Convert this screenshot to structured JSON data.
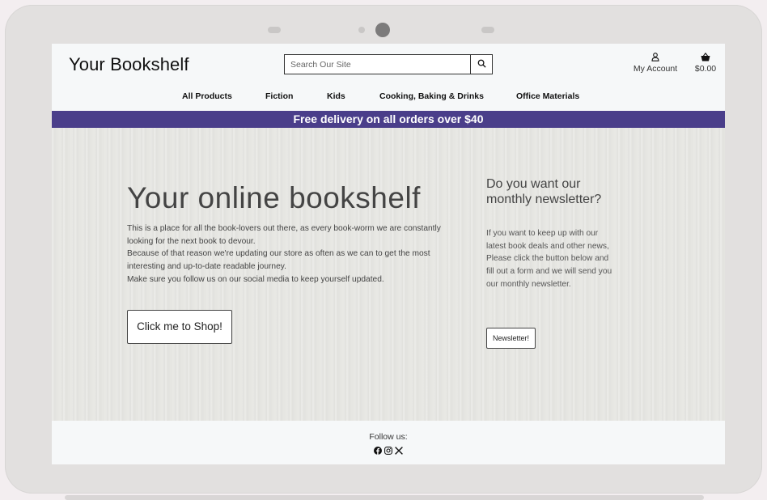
{
  "site": {
    "logo": "Your Bookshelf"
  },
  "search": {
    "placeholder": "Search Our Site",
    "icon": "search-icon"
  },
  "account": {
    "label": "My Account",
    "icon": "user-icon"
  },
  "cart": {
    "total": "$0.00",
    "icon": "basket-icon"
  },
  "nav": {
    "items": [
      {
        "label": "All Products"
      },
      {
        "label": "Fiction"
      },
      {
        "label": "Kids"
      },
      {
        "label": "Cooking, Baking & Drinks"
      },
      {
        "label": "Office Materials"
      }
    ]
  },
  "banner": {
    "text": "Free delivery on all orders over $40"
  },
  "hero": {
    "title": "Your online bookshelf",
    "paragraphs": [
      "This is a place for all the book-lovers out there, as every book-worm we are constantly looking for the next book to devour.",
      "Because of that reason we're updating our store as often as we can to get the most interesting and up-to-date readable journey.",
      "Make sure you follow us on our social media to keep yourself updated."
    ],
    "button_label": "Click me to Shop!"
  },
  "newsletter": {
    "title": "Do you want our monthly newsletter?",
    "text": "If you want to keep up with our latest book deals and other news, Please click the button below and fill out a form and we will send you our monthly newsletter.",
    "button_label": "Newsletter!"
  },
  "footer": {
    "follow_label": "Follow us:",
    "social_icons": [
      "facebook-icon",
      "instagram-icon",
      "x-icon"
    ]
  },
  "colors": {
    "banner": "#4a3e8a",
    "hero_bg": "#e6e6e2",
    "header_bg": "#f6f8f9",
    "device_frame": "#e2e0df"
  }
}
